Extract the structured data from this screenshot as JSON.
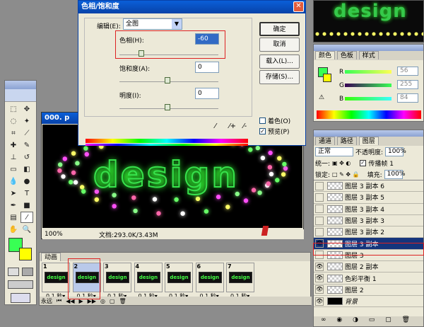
{
  "dialog": {
    "title": "色相/饱和度",
    "edit_label": "编辑(E):",
    "edit_value": "全图",
    "hue_label": "色相(H):",
    "hue_value": "-60",
    "saturation_label": "饱和度(A):",
    "saturation_value": "0",
    "lightness_label": "明度(I):",
    "lightness_value": "0",
    "ok": "确定",
    "cancel": "取消",
    "load": "载入(L)...",
    "save": "存储(S)...",
    "colorize": "着色(O)",
    "preview": "预览(P)",
    "preview_checked": true
  },
  "document": {
    "title": "000. p",
    "zoom": "100%",
    "doc_info": "文档:293.0K/3.43M",
    "art_text": "design"
  },
  "color_panel": {
    "tabs": [
      "颜色",
      "色板",
      "样式"
    ],
    "r_value": "56",
    "g_value": "255",
    "b_value": "84",
    "r_label": "R",
    "g_label": "G",
    "b_label": "B"
  },
  "layers_panel": {
    "tabs": [
      "通道",
      "路径",
      "图层"
    ],
    "blend_mode": "正常",
    "opacity_label": "不透明度:",
    "opacity_value": "100%",
    "unify_label": "统一:",
    "propagate_label": "传播帧 1",
    "lock_label": "锁定:",
    "fill_label": "填充:",
    "fill_value": "100%",
    "layers": [
      {
        "name": "图层 3 副本 6",
        "visible": false
      },
      {
        "name": "图层 3 副本 5",
        "visible": false
      },
      {
        "name": "图层 3 副本 4",
        "visible": false
      },
      {
        "name": "图层 3 副本 3",
        "visible": false
      },
      {
        "name": "图层 3 副本 2",
        "visible": false
      },
      {
        "name": "图层 3 副本",
        "visible": true,
        "selected": true
      },
      {
        "name": "图层 3",
        "visible": false
      },
      {
        "name": "图层 2 副本",
        "visible": true
      },
      {
        "name": "色彩平衡 1",
        "visible": true
      },
      {
        "name": "图层 2",
        "visible": true
      },
      {
        "name": "背景",
        "visible": true
      }
    ]
  },
  "animation": {
    "title": "动画",
    "loop": "永远",
    "frames": [
      {
        "num": "1",
        "time": "0.1 秒"
      },
      {
        "num": "2",
        "time": "0.1 秒"
      },
      {
        "num": "3",
        "time": "0.1 秒"
      },
      {
        "num": "4",
        "time": "0.1 秒"
      },
      {
        "num": "5",
        "time": "0.1 秒"
      },
      {
        "num": "6",
        "time": "0.1 秒"
      },
      {
        "num": "7",
        "time": "0.1 秒"
      }
    ]
  },
  "colors": {
    "foreground": "#38ff54",
    "background": "#ffff00",
    "title_blue": "#0842a8",
    "highlight_red": "#d22"
  }
}
